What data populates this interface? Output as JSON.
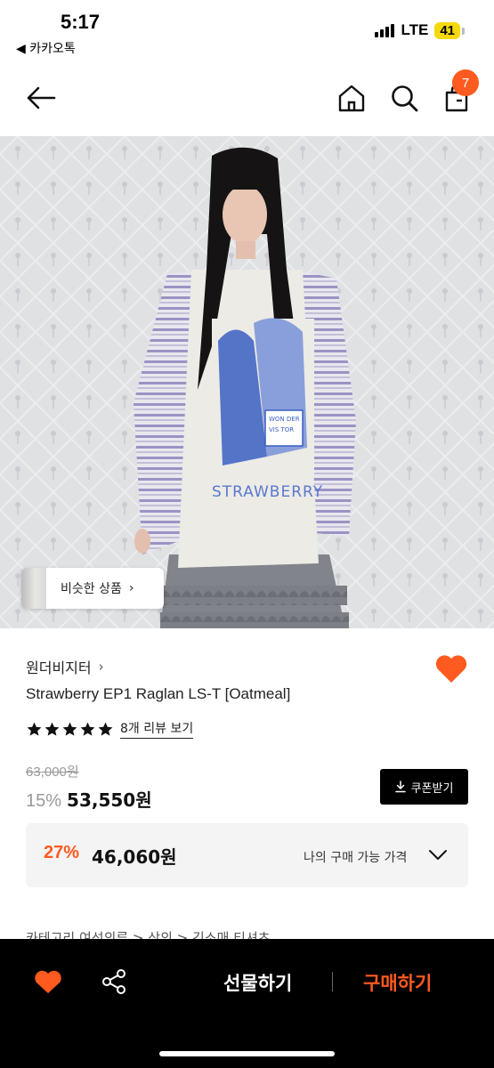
{
  "status_bar": {
    "time": "5:17",
    "back_app": "◀ 카카오톡",
    "network": "LTE",
    "battery": "41"
  },
  "nav": {
    "cart_count": "7"
  },
  "hero": {
    "shirt_print_text": "STRAWBERRY",
    "shirt_tag_text": "WON DER VIS TOR",
    "similar_label": "비슷한 상품"
  },
  "product": {
    "brand": "원더비지터",
    "title": "Strawberry EP1 Raglan LS-T [Oatmeal]",
    "rating_stars": 5,
    "review_link": "8개 리뷰 보기",
    "original_price": "63,000원",
    "discount_rate": "15%",
    "price": "53,550원",
    "coupon_label": "쿠폰받기",
    "my_price": {
      "discount_rate": "27%",
      "price": "46,060원",
      "label": "나의 구매 가능 가격"
    },
    "category_path": "카테고리   여성의류 > 상의 > 긴소매 티셔츠"
  },
  "bottom_bar": {
    "gift_label": "선물하기",
    "buy_label": "구매하기"
  },
  "colors": {
    "accent": "#ff5a1f",
    "black": "#000000",
    "panel": "#f4f4f5"
  }
}
